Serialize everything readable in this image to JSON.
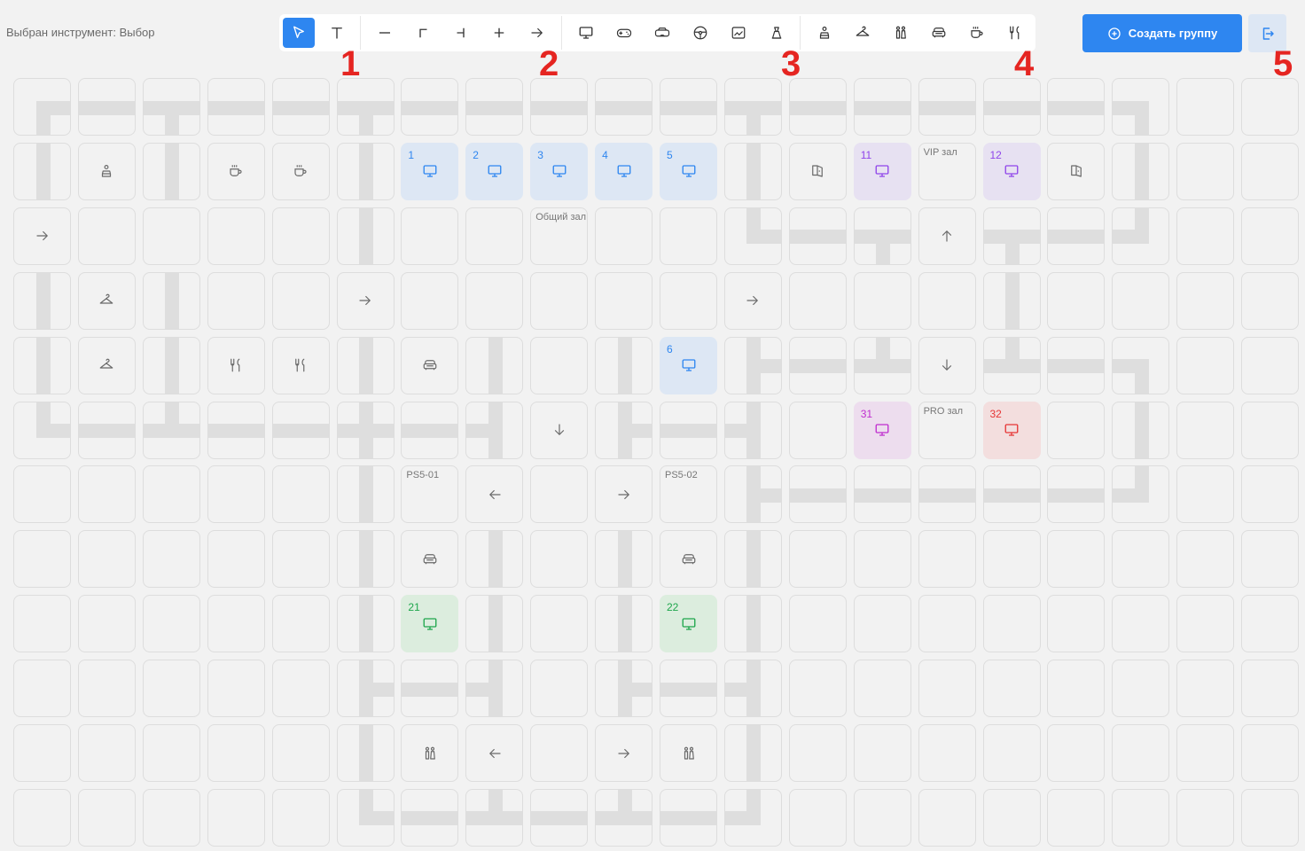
{
  "status_text": "Выбран инструмент: Выбор",
  "toolbar": {
    "tools": [
      {
        "icon": "cursor-icon",
        "active": true
      },
      {
        "icon": "text-icon"
      },
      {
        "icon": "line-horizontal-icon"
      },
      {
        "icon": "corner-icon"
      },
      {
        "icon": "t-junction-icon"
      },
      {
        "icon": "cross-icon"
      },
      {
        "icon": "arrow-right-icon"
      },
      {
        "icon": "monitor-icon"
      },
      {
        "icon": "gamepad-icon"
      },
      {
        "icon": "vr-headset-icon"
      },
      {
        "icon": "steering-wheel-icon"
      },
      {
        "icon": "projector-icon"
      },
      {
        "icon": "water-cooler-icon"
      },
      {
        "icon": "reception-icon"
      },
      {
        "icon": "hanger-icon"
      },
      {
        "icon": "restroom-icon"
      },
      {
        "icon": "sofa-icon"
      },
      {
        "icon": "coffee-icon"
      },
      {
        "icon": "restaurant-icon"
      }
    ]
  },
  "create_group_label": "Создать группу",
  "markers": [
    "1",
    "2",
    "3",
    "4",
    "5"
  ],
  "colors": {
    "accent": "#2e86f0",
    "blue_pc": "#2e86f0",
    "purple_pc": "#8f45ea",
    "pink_pc": "#c02ecf",
    "red_pc": "#e63535",
    "green_pc": "#1ea64c",
    "marker": "#e52521"
  },
  "grid": {
    "cols": 20,
    "rows": 12,
    "cells": [
      {
        "c": 0,
        "r": 0,
        "road": "corner-es"
      },
      {
        "c": 1,
        "r": 0,
        "road": "h"
      },
      {
        "c": 2,
        "r": 0,
        "road": "t-down"
      },
      {
        "c": 3,
        "r": 0,
        "road": "h"
      },
      {
        "c": 4,
        "r": 0,
        "road": "h"
      },
      {
        "c": 5,
        "r": 0,
        "road": "t-down"
      },
      {
        "c": 6,
        "r": 0,
        "road": "h"
      },
      {
        "c": 7,
        "r": 0,
        "road": "h"
      },
      {
        "c": 8,
        "r": 0,
        "road": "h"
      },
      {
        "c": 9,
        "r": 0,
        "road": "h"
      },
      {
        "c": 10,
        "r": 0,
        "road": "h"
      },
      {
        "c": 11,
        "r": 0,
        "road": "t-down"
      },
      {
        "c": 12,
        "r": 0,
        "road": "h"
      },
      {
        "c": 13,
        "r": 0,
        "road": "h"
      },
      {
        "c": 14,
        "r": 0,
        "road": "h"
      },
      {
        "c": 15,
        "r": 0,
        "road": "h"
      },
      {
        "c": 16,
        "r": 0,
        "road": "h"
      },
      {
        "c": 17,
        "r": 0,
        "road": "corner-ws"
      },
      {
        "c": 0,
        "r": 1,
        "road": "v"
      },
      {
        "c": 1,
        "r": 1,
        "icon": "reception-icon"
      },
      {
        "c": 2,
        "r": 1,
        "road": "v"
      },
      {
        "c": 3,
        "r": 1,
        "icon": "coffee-icon"
      },
      {
        "c": 4,
        "r": 1,
        "icon": "coffee-icon"
      },
      {
        "c": 5,
        "r": 1,
        "road": "v"
      },
      {
        "c": 6,
        "r": 1,
        "pc": "blue",
        "num": "1"
      },
      {
        "c": 7,
        "r": 1,
        "pc": "blue",
        "num": "2"
      },
      {
        "c": 8,
        "r": 1,
        "pc": "blue",
        "num": "3"
      },
      {
        "c": 9,
        "r": 1,
        "pc": "blue",
        "num": "4"
      },
      {
        "c": 10,
        "r": 1,
        "pc": "blue",
        "num": "5"
      },
      {
        "c": 11,
        "r": 1,
        "road": "v"
      },
      {
        "c": 12,
        "r": 1,
        "icon": "door-icon"
      },
      {
        "c": 13,
        "r": 1,
        "pc": "purple",
        "num": "11"
      },
      {
        "c": 14,
        "r": 1,
        "label": "VIP зал"
      },
      {
        "c": 15,
        "r": 1,
        "pc": "purple",
        "num": "12"
      },
      {
        "c": 16,
        "r": 1,
        "icon": "door-icon"
      },
      {
        "c": 17,
        "r": 1,
        "road": "v"
      },
      {
        "c": 0,
        "r": 2,
        "icon": "arrow-right-icon"
      },
      {
        "c": 5,
        "r": 2,
        "road": "v"
      },
      {
        "c": 8,
        "r": 2,
        "label": "Общий зал"
      },
      {
        "c": 11,
        "r": 2,
        "road": "corner-ne"
      },
      {
        "c": 12,
        "r": 2,
        "road": "h"
      },
      {
        "c": 13,
        "r": 2,
        "road": "t-down"
      },
      {
        "c": 14,
        "r": 2,
        "icon": "arrow-up-icon"
      },
      {
        "c": 15,
        "r": 2,
        "road": "t-down"
      },
      {
        "c": 16,
        "r": 2,
        "road": "h"
      },
      {
        "c": 17,
        "r": 2,
        "road": "corner-nw"
      },
      {
        "c": 0,
        "r": 3,
        "road": "v"
      },
      {
        "c": 1,
        "r": 3,
        "icon": "hanger-icon"
      },
      {
        "c": 2,
        "r": 3,
        "road": "v"
      },
      {
        "c": 5,
        "r": 3,
        "icon": "arrow-right-icon"
      },
      {
        "c": 11,
        "r": 3,
        "icon": "arrow-right-icon"
      },
      {
        "c": 15,
        "r": 3,
        "road": "v"
      },
      {
        "c": 0,
        "r": 4,
        "road": "v"
      },
      {
        "c": 1,
        "r": 4,
        "icon": "hanger-icon"
      },
      {
        "c": 2,
        "r": 4,
        "road": "v"
      },
      {
        "c": 3,
        "r": 4,
        "icon": "restaurant-icon"
      },
      {
        "c": 4,
        "r": 4,
        "icon": "restaurant-icon"
      },
      {
        "c": 5,
        "r": 4,
        "road": "v"
      },
      {
        "c": 6,
        "r": 4,
        "icon": "sofa-icon"
      },
      {
        "c": 7,
        "r": 4,
        "road": "v"
      },
      {
        "c": 9,
        "r": 4,
        "road": "v"
      },
      {
        "c": 10,
        "r": 4,
        "pc": "blue",
        "num": "6"
      },
      {
        "c": 11,
        "r": 4,
        "road": "t-right"
      },
      {
        "c": 12,
        "r": 4,
        "road": "h"
      },
      {
        "c": 13,
        "r": 4,
        "road": "t-up"
      },
      {
        "c": 14,
        "r": 4,
        "icon": "arrow-down-icon"
      },
      {
        "c": 15,
        "r": 4,
        "road": "t-up"
      },
      {
        "c": 16,
        "r": 4,
        "road": "h"
      },
      {
        "c": 17,
        "r": 4,
        "road": "corner-ws"
      },
      {
        "c": 0,
        "r": 5,
        "road": "corner-ne"
      },
      {
        "c": 1,
        "r": 5,
        "road": "h"
      },
      {
        "c": 2,
        "r": 5,
        "road": "t-up"
      },
      {
        "c": 3,
        "r": 5,
        "road": "h"
      },
      {
        "c": 4,
        "r": 5,
        "road": "h"
      },
      {
        "c": 5,
        "r": 5,
        "road": "cross"
      },
      {
        "c": 6,
        "r": 5,
        "road": "h"
      },
      {
        "c": 7,
        "r": 5,
        "road": "t-left"
      },
      {
        "c": 8,
        "r": 5,
        "icon": "arrow-down-icon"
      },
      {
        "c": 9,
        "r": 5,
        "road": "t-right"
      },
      {
        "c": 10,
        "r": 5,
        "road": "h"
      },
      {
        "c": 11,
        "r": 5,
        "road": "t-left"
      },
      {
        "c": 13,
        "r": 5,
        "pc": "pink",
        "num": "31"
      },
      {
        "c": 14,
        "r": 5,
        "label": "PRO зал"
      },
      {
        "c": 15,
        "r": 5,
        "pc": "red",
        "num": "32"
      },
      {
        "c": 17,
        "r": 5,
        "road": "v"
      },
      {
        "c": 5,
        "r": 6,
        "road": "v"
      },
      {
        "c": 6,
        "r": 6,
        "label": "PS5-01"
      },
      {
        "c": 7,
        "r": 6,
        "icon": "arrow-left-icon"
      },
      {
        "c": 9,
        "r": 6,
        "icon": "arrow-right-icon"
      },
      {
        "c": 10,
        "r": 6,
        "label": "PS5-02"
      },
      {
        "c": 11,
        "r": 6,
        "road": "t-right"
      },
      {
        "c": 12,
        "r": 6,
        "road": "h"
      },
      {
        "c": 13,
        "r": 6,
        "road": "h"
      },
      {
        "c": 14,
        "r": 6,
        "road": "h"
      },
      {
        "c": 15,
        "r": 6,
        "road": "h"
      },
      {
        "c": 16,
        "r": 6,
        "road": "h"
      },
      {
        "c": 17,
        "r": 6,
        "road": "corner-nw"
      },
      {
        "c": 5,
        "r": 7,
        "road": "v"
      },
      {
        "c": 6,
        "r": 7,
        "icon": "sofa-icon"
      },
      {
        "c": 7,
        "r": 7,
        "road": "v"
      },
      {
        "c": 9,
        "r": 7,
        "road": "v"
      },
      {
        "c": 10,
        "r": 7,
        "icon": "sofa-icon"
      },
      {
        "c": 11,
        "r": 7,
        "road": "v"
      },
      {
        "c": 5,
        "r": 8,
        "road": "v"
      },
      {
        "c": 6,
        "r": 8,
        "pc": "green",
        "num": "21"
      },
      {
        "c": 7,
        "r": 8,
        "road": "v"
      },
      {
        "c": 9,
        "r": 8,
        "road": "v"
      },
      {
        "c": 10,
        "r": 8,
        "pc": "green",
        "num": "22"
      },
      {
        "c": 11,
        "r": 8,
        "road": "v"
      },
      {
        "c": 5,
        "r": 9,
        "road": "t-right"
      },
      {
        "c": 6,
        "r": 9,
        "road": "h"
      },
      {
        "c": 7,
        "r": 9,
        "road": "t-left"
      },
      {
        "c": 9,
        "r": 9,
        "road": "t-right"
      },
      {
        "c": 10,
        "r": 9,
        "road": "h"
      },
      {
        "c": 11,
        "r": 9,
        "road": "t-left"
      },
      {
        "c": 5,
        "r": 10,
        "road": "v"
      },
      {
        "c": 6,
        "r": 10,
        "icon": "restroom-icon"
      },
      {
        "c": 7,
        "r": 10,
        "icon": "arrow-left-icon"
      },
      {
        "c": 9,
        "r": 10,
        "icon": "arrow-right-icon"
      },
      {
        "c": 10,
        "r": 10,
        "icon": "restroom-icon"
      },
      {
        "c": 11,
        "r": 10,
        "road": "v"
      },
      {
        "c": 5,
        "r": 11,
        "road": "corner-ne"
      },
      {
        "c": 6,
        "r": 11,
        "road": "h"
      },
      {
        "c": 7,
        "r": 11,
        "road": "t-up"
      },
      {
        "c": 8,
        "r": 11,
        "road": "h"
      },
      {
        "c": 9,
        "r": 11,
        "road": "t-up"
      },
      {
        "c": 10,
        "r": 11,
        "road": "h"
      },
      {
        "c": 11,
        "r": 11,
        "road": "corner-nw"
      }
    ]
  }
}
